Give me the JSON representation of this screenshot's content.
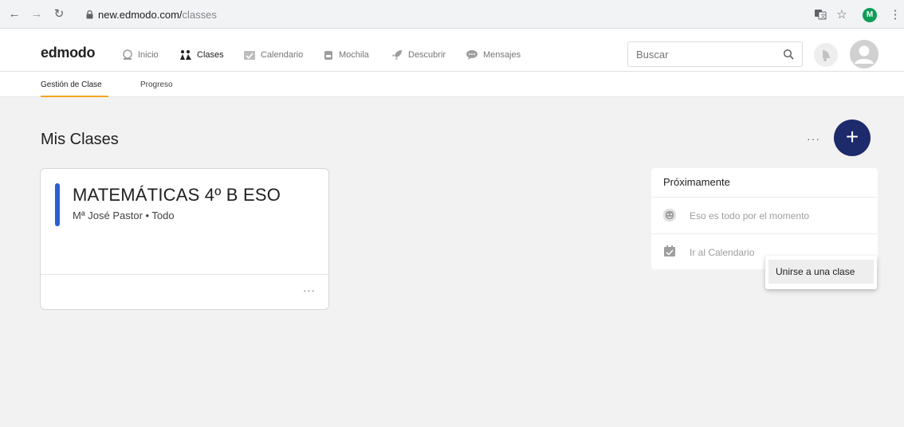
{
  "browser": {
    "url_host": "new.edmodo.com/",
    "url_path": "classes",
    "profile_initial": "M"
  },
  "app": {
    "logo": "edmodo",
    "nav": [
      {
        "label": "Inicio",
        "icon": "home-icon"
      },
      {
        "label": "Clases",
        "icon": "classes-icon"
      },
      {
        "label": "Calendario",
        "icon": "calendar-icon"
      },
      {
        "label": "Mochila",
        "icon": "backpack-icon"
      },
      {
        "label": "Descubrir",
        "icon": "rocket-icon"
      },
      {
        "label": "Mensajes",
        "icon": "message-icon"
      }
    ],
    "search_placeholder": "Buscar"
  },
  "subnav": {
    "tabs": [
      "Gestión de Clase",
      "Progreso"
    ]
  },
  "main": {
    "title": "Mis Clases",
    "fab_label": "+",
    "more_label": "···",
    "dropdown": {
      "item": "Unirse a una clase"
    },
    "class_card": {
      "name": "MATEMÁTICAS 4º B ESO",
      "subtitle": "Mª José Pastor • Todo",
      "accent": "#2a5fd1",
      "more_label": "···"
    },
    "upcoming": {
      "title": "Próximamente",
      "rows": [
        {
          "label": "Eso es todo por el momento",
          "icon": "smiley-icon"
        },
        {
          "label": "Ir al Calendario",
          "icon": "calendar-icon"
        }
      ]
    }
  },
  "colors": {
    "fab": "#1d2a6b",
    "tab_underline": "#f5a623",
    "page_bg": "#f2f2f2"
  }
}
